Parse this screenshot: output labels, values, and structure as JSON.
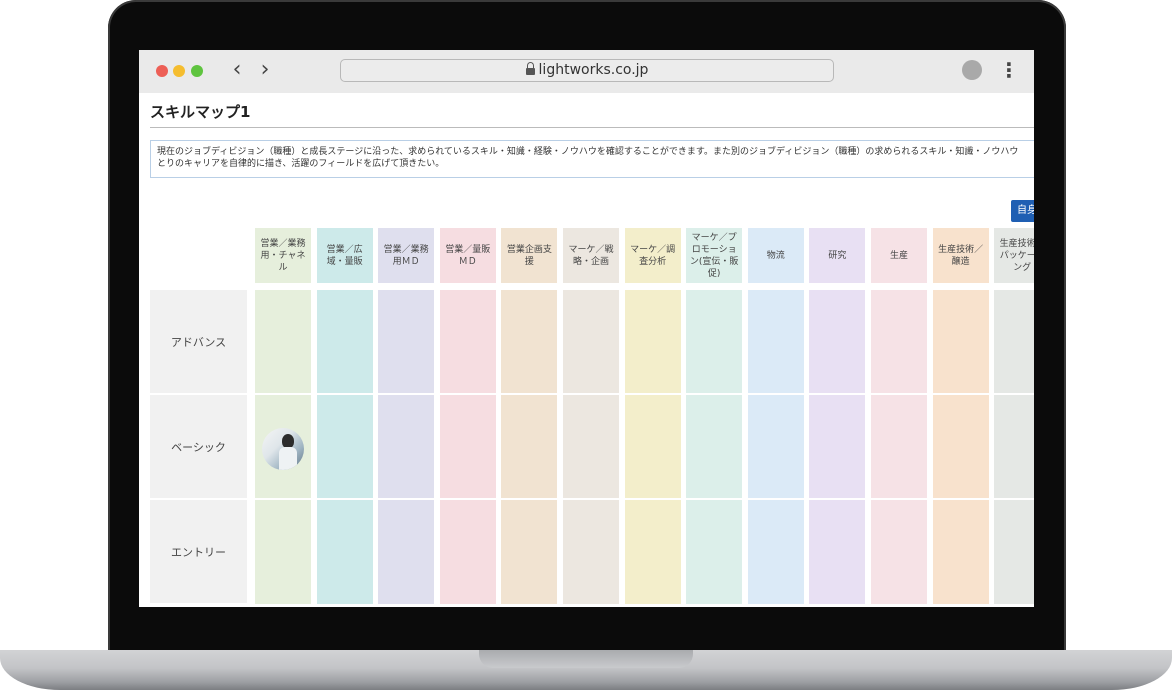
{
  "browser": {
    "url": "lightworks.co.jp",
    "back_icon": "‹",
    "forward_icon": "›",
    "menu_icon": "⋮"
  },
  "page": {
    "title": "スキルマップ1",
    "description_line1": "現在のジョブディビジョン（職種）と成長ステージに沿った、求められているスキル・知識・経験・ノウハウを確認することができます。また別のジョブディビジョン（職種）の求められるスキル・知識・ノウハウ",
    "description_line2": "とりのキャリアを自律的に描き、活躍のフィールドを広げて頂きたい。",
    "self_button": "自身"
  },
  "skill_map": {
    "columns": [
      {
        "label": "営業／業務用・チャネル",
        "color": "#e6efdc"
      },
      {
        "label": "営業／広域・量販",
        "color": "#cdeaea"
      },
      {
        "label": "営業／業務用ＭＤ",
        "color": "#dfdfee"
      },
      {
        "label": "営業／量販ＭＤ",
        "color": "#f6dde1"
      },
      {
        "label": "営業企画支援",
        "color": "#f1e3d1"
      },
      {
        "label": "マーケ／戦略・企画",
        "color": "#ece7e0"
      },
      {
        "label": "マーケ／調査分析",
        "color": "#f3eecb"
      },
      {
        "label": "マーケ／プロモーション(宣伝・販促)",
        "color": "#dcefea"
      },
      {
        "label": "物流",
        "color": "#dbeaf7"
      },
      {
        "label": "研究",
        "color": "#e8e0f3"
      },
      {
        "label": "生産",
        "color": "#f6e2e6"
      },
      {
        "label": "生産技術／醸造",
        "color": "#f8e2cd"
      },
      {
        "label": "生産技術／パッケージング",
        "color": "#e5e8e5"
      }
    ],
    "rows": [
      "アドバンス",
      "ベーシック",
      "エントリー"
    ],
    "current_position": {
      "column": "営業／業務用・チャネル",
      "row": "ベーシック"
    }
  }
}
